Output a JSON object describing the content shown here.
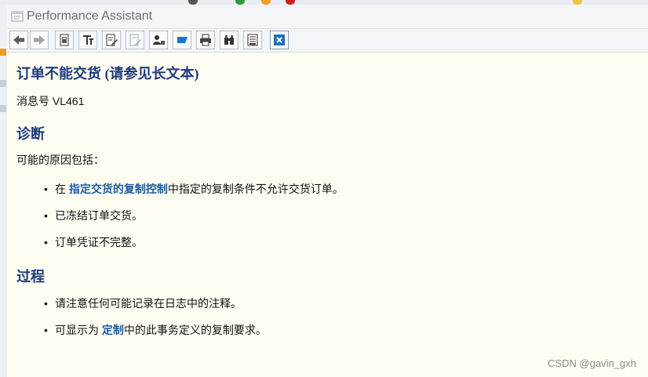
{
  "window": {
    "title": "Performance Assistant"
  },
  "toolbar": {
    "buttons": [
      {
        "icon": "back-arrow-icon"
      },
      {
        "icon": "forward-arrow-icon"
      },
      {
        "icon": "document-icon"
      },
      {
        "icon": "technical-info-icon"
      },
      {
        "icon": "edit-document-icon"
      },
      {
        "icon": "highlight-icon"
      },
      {
        "icon": "user-settings-icon"
      },
      {
        "icon": "flag-icon"
      },
      {
        "icon": "print-icon"
      },
      {
        "icon": "binoculars-icon"
      },
      {
        "icon": "save-document-icon"
      },
      {
        "icon": "close-icon"
      }
    ]
  },
  "content": {
    "heading": "订单不能交货 (请参见长文本)",
    "message_number": "消息号 VL461",
    "diagnosis": {
      "title": "诊断",
      "intro": "可能的原因包括：",
      "items": [
        {
          "prefix": "在 ",
          "link": "指定交货的复制控制",
          "suffix": "中指定的复制条件不允许交货订单。"
        },
        {
          "text": "已冻结订单交货。"
        },
        {
          "text": "订单凭证不完整。"
        }
      ]
    },
    "procedure": {
      "title": "过程",
      "items": [
        {
          "text": "请注意任何可能记录在日志中的注释。"
        },
        {
          "prefix": "可显示为 ",
          "link": "定制",
          "suffix": "中的此事务定义的复制要求。"
        }
      ]
    }
  },
  "watermark": "CSDN @gavin_gxh",
  "colors": {
    "background": "#fefef2",
    "heading": "#1f3a7a",
    "link": "#1c5aa0"
  }
}
